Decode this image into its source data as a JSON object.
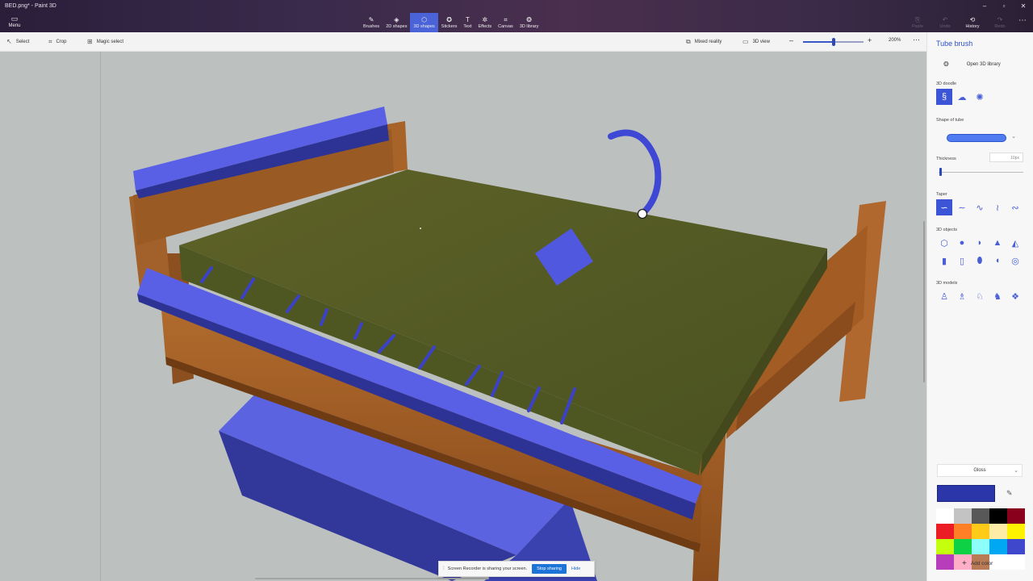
{
  "window": {
    "title": "BED.png* - Paint 3D",
    "controls": [
      "–",
      "▫",
      "✕"
    ]
  },
  "menu": {
    "label": "Menu",
    "icon": "menu-icon"
  },
  "toolbar": {
    "tools": [
      {
        "label": "Brushes",
        "icon": "✎",
        "name": "tool-brushes"
      },
      {
        "label": "2D shapes",
        "icon": "◈",
        "name": "tool-2d-shapes"
      },
      {
        "label": "3D shapes",
        "icon": "⬡",
        "name": "tool-3d-shapes",
        "active": true
      },
      {
        "label": "Stickers",
        "icon": "✪",
        "name": "tool-stickers"
      },
      {
        "label": "Text",
        "icon": "T",
        "name": "tool-text"
      },
      {
        "label": "Effects",
        "icon": "✲",
        "name": "tool-effects"
      },
      {
        "label": "Canvas",
        "icon": "⌗",
        "name": "tool-canvas"
      },
      {
        "label": "3D library",
        "icon": "❂",
        "name": "tool-3d-library"
      }
    ],
    "right": [
      {
        "label": "Paste",
        "icon": "⎘",
        "name": "paste-button",
        "enabled": false
      },
      {
        "label": "Undo",
        "icon": "↶",
        "name": "undo-button",
        "enabled": false
      },
      {
        "label": "History",
        "icon": "⟲",
        "name": "history-button",
        "enabled": true
      },
      {
        "label": "Redo",
        "icon": "↷",
        "name": "redo-button",
        "enabled": false
      }
    ],
    "more_icon": "⋯"
  },
  "subbar": {
    "select": "Select",
    "crop": "Crop",
    "magic_select": "Magic select",
    "mixed_reality": "Mixed reality",
    "view_3d": "3D view",
    "zoom_minus": "–",
    "zoom_plus": "+",
    "zoom_value": "200%",
    "zoom_fraction": 0.5,
    "more": "⋯"
  },
  "recorder": {
    "message": "Screen Recorder is sharing your screen.",
    "stop": "Stop sharing",
    "hide": "Hide"
  },
  "panel": {
    "title": "Tube brush",
    "open_library": "Open 3D library",
    "doodle_label": "3D doodle",
    "doodle_icons": [
      "tube-doodle-icon",
      "soft-doodle-icon",
      "sharp-doodle-icon"
    ],
    "shape_label": "Shape of tube",
    "thickness_label": "Thickness",
    "thickness_value": "10px",
    "thickness_fraction": 0.02,
    "taper_label": "Taper",
    "taper_icons": [
      "taper-none-icon",
      "taper-start-icon",
      "taper-end-icon",
      "taper-both-icon",
      "taper-middle-icon"
    ],
    "objects_label": "3D objects",
    "objects_row1": [
      "cube-icon",
      "sphere-icon",
      "hemisphere-icon",
      "cone-icon",
      "pyramid-icon"
    ],
    "objects_row2": [
      "cylinder-icon",
      "tube-icon",
      "capsule-icon",
      "curved-cylinder-icon",
      "donut-icon"
    ],
    "models_label": "3D models",
    "models": [
      "man-model-icon",
      "woman-model-icon",
      "dog-model-icon",
      "cat-model-icon",
      "fish-model-icon"
    ],
    "material": "Gloss",
    "current_color": "#2b37a8",
    "add_color": "Add color",
    "palette": [
      "#ffffff",
      "#c3c3c3",
      "#585858",
      "#000000",
      "#88001b",
      "#ec1c24",
      "#ff7f27",
      "#ffca18",
      "#fdeca6",
      "#fff200",
      "#c4ff0e",
      "#0ed145",
      "#8cfffb",
      "#00a8f3",
      "#3f48cc",
      "#b83dba",
      "#ffaec8",
      "#b97a56",
      "#ffffff",
      "#ffffff"
    ]
  }
}
